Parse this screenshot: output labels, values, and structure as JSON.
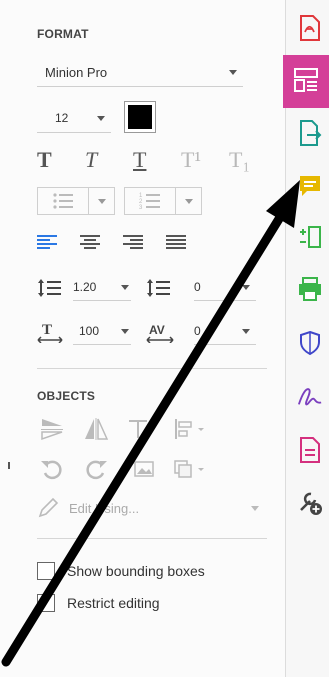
{
  "format": {
    "title": "FORMAT",
    "font_family": "Minion Pro",
    "font_size": "12",
    "text_color": "#000000",
    "styles": [
      "T",
      "T",
      "T",
      "T¹",
      "T₁"
    ],
    "line_spacing": "1.20",
    "para_spacing": "0",
    "horiz_scale": "100",
    "char_spacing": "0"
  },
  "objects": {
    "title": "OBJECTS",
    "edit_using": "Edit Using..."
  },
  "options": {
    "show_bounding": "Show bounding boxes",
    "restrict": "Restrict editing"
  },
  "colors": {
    "accent": "#d43f98",
    "export_pdf": "#1c9a8e",
    "comment": "#e6b800",
    "organize": "#3bb54a",
    "protect": "#3f46c9",
    "fill_sign": "#7b3fbf",
    "create_pdf": "#d4307e",
    "red": "#e0373b"
  }
}
